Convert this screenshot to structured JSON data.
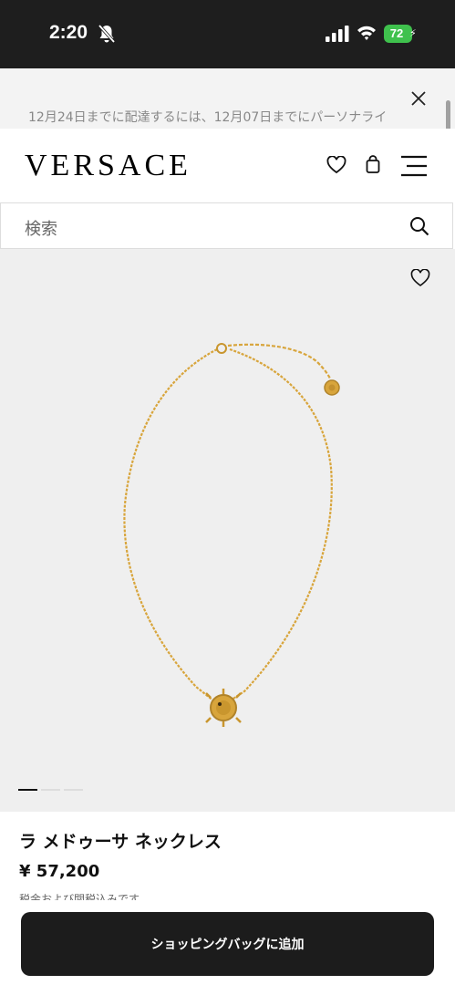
{
  "status_bar": {
    "time": "2:20",
    "battery": "72"
  },
  "promo": {
    "text": "12月24日までに配達するには、12月07日までにパーソナライ"
  },
  "header": {
    "logo": "VERSACE"
  },
  "search": {
    "placeholder": "検索"
  },
  "product": {
    "name": "ラ メドゥーサ ネックレス",
    "price": "¥ 57,200",
    "tax_note": "税金および関税込みです。",
    "carousel": {
      "total": 3,
      "active": 1
    }
  },
  "actions": {
    "add_to_bag": "ショッピングバッグに追加"
  },
  "icons": [
    "bell-slash-icon",
    "signal-icon",
    "wifi-icon",
    "battery-icon",
    "close-icon",
    "heart-icon",
    "shopping-bag-icon",
    "menu-icon",
    "search-icon"
  ],
  "colors": {
    "status_bar": "#1e1e1e",
    "battery": "#3fc14d",
    "gold": "#d8a53c",
    "button": "#1c1c1c"
  }
}
